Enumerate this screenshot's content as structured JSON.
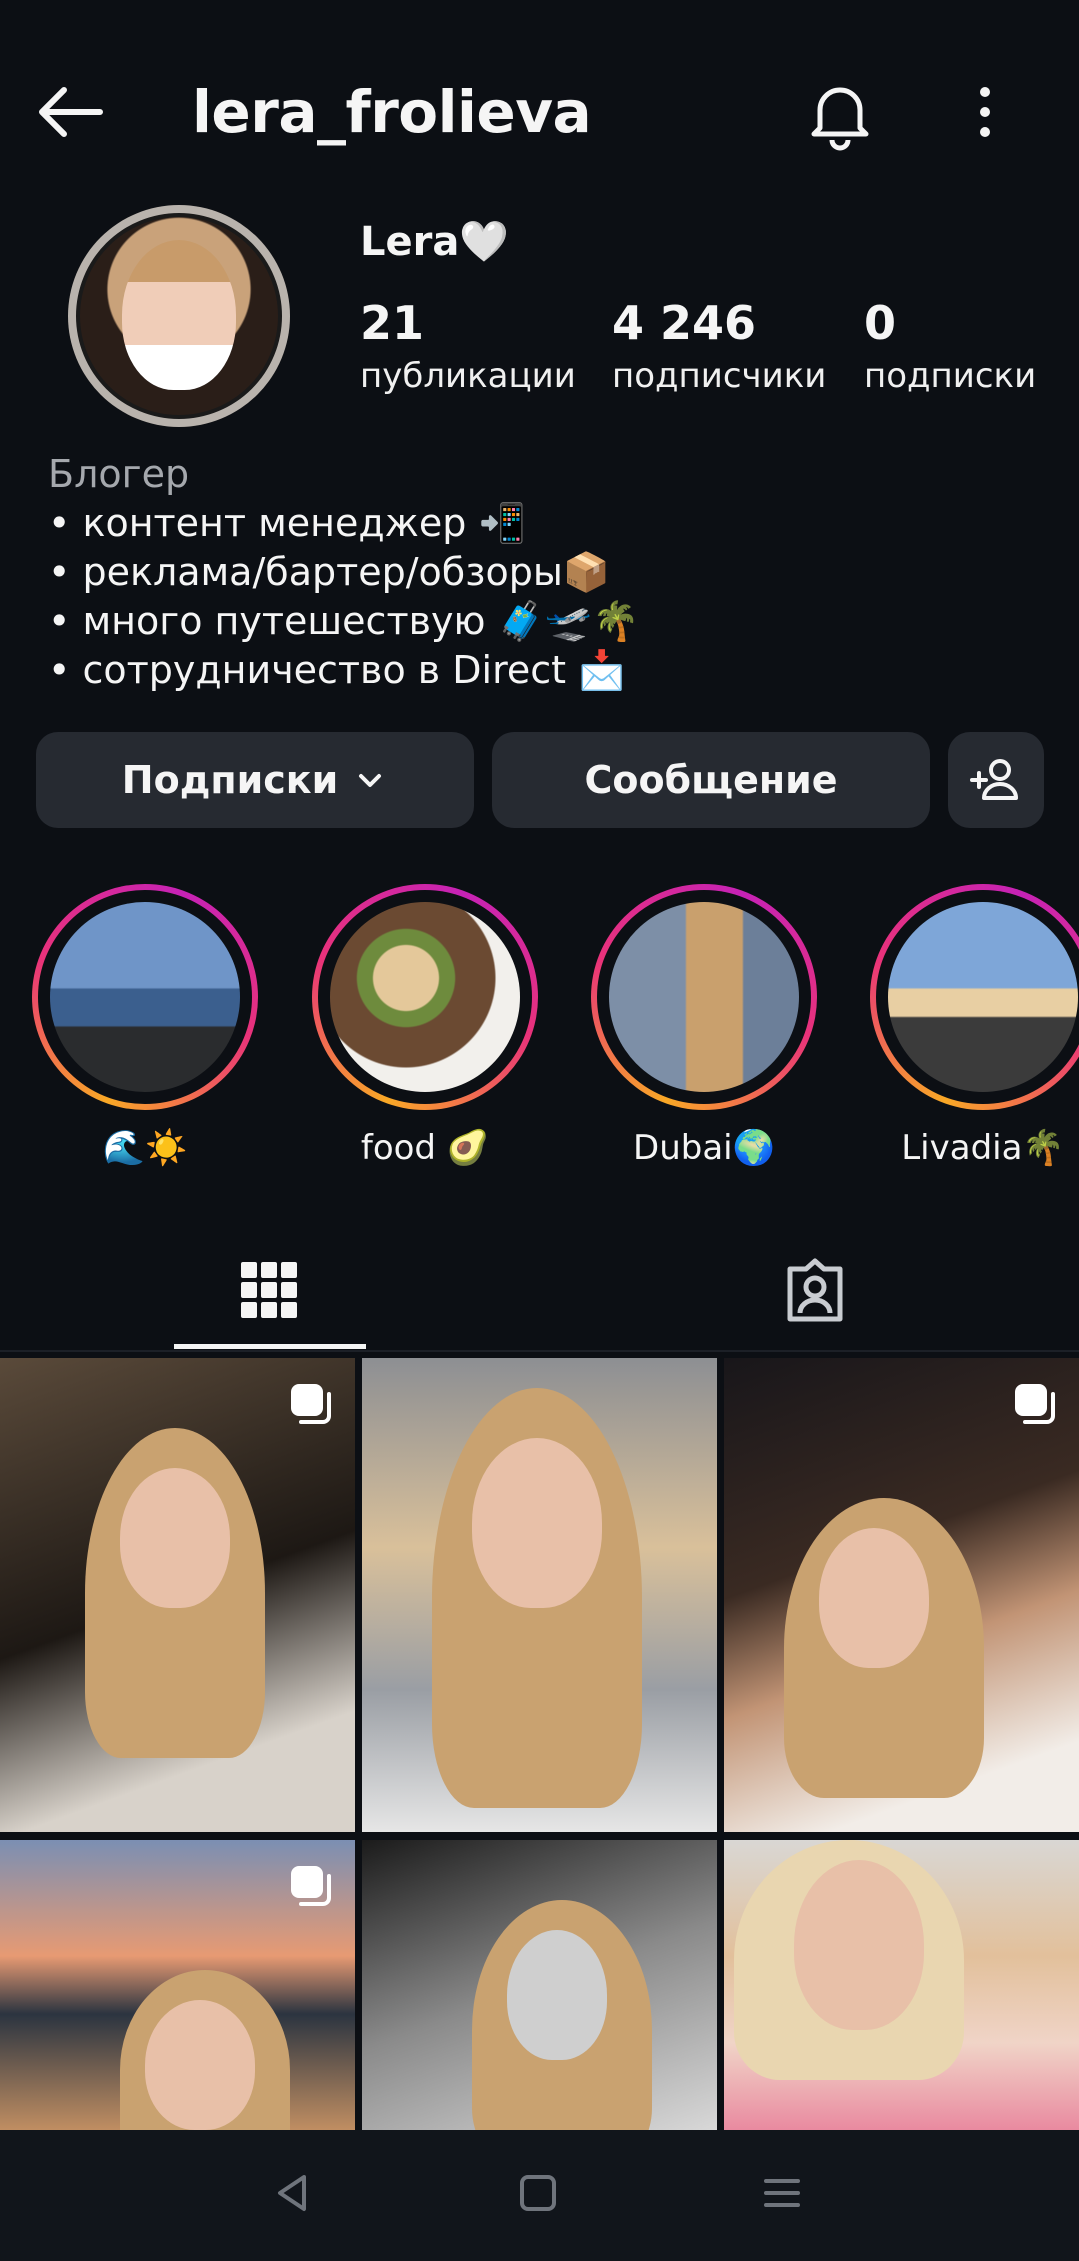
{
  "header": {
    "username": "lera_frolieva",
    "back_icon": "arrow-left-icon",
    "bell_icon": "bell-icon",
    "more_icon": "kebab-menu-icon"
  },
  "profile": {
    "display_name": "Lera🤍",
    "stats": [
      {
        "value": "21",
        "label": "публикации"
      },
      {
        "value": "4 246",
        "label": "подписчики"
      },
      {
        "value": "0",
        "label": "подписки"
      }
    ],
    "category": "Блогер",
    "bio_lines": [
      "• контент менеджер 📲",
      "• реклама/бартер/обзоры📦",
      "• много путешествую 🧳🛫🌴",
      "• сотрудничество в Direct 📩"
    ]
  },
  "actions": {
    "following_label": "Подписки",
    "message_label": "Сообщение",
    "add_user_icon": "add-user-icon"
  },
  "highlights": [
    {
      "label": "🌊☀️"
    },
    {
      "label": "food 🥑"
    },
    {
      "label": "Dubai🌍"
    },
    {
      "label": "Livadia🌴"
    }
  ],
  "tabs": [
    {
      "icon": "grid-icon",
      "active": true
    },
    {
      "icon": "tagged-icon",
      "active": false
    }
  ],
  "colors": {
    "background": "#0c0f14",
    "button_bg": "#262a31",
    "story_ring_start": "#f9a826",
    "story_ring_end": "#c622b6"
  }
}
